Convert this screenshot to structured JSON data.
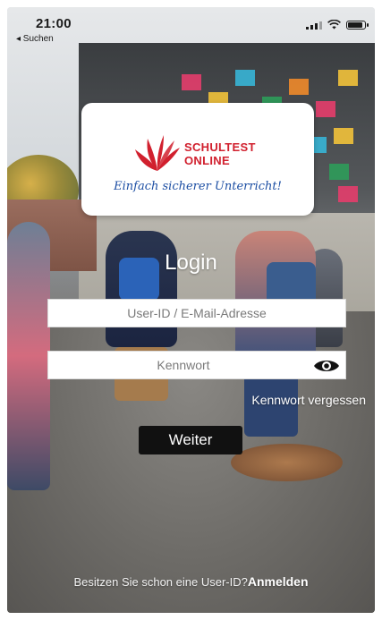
{
  "status_bar": {
    "time": "21:00",
    "back_label": "◂ Suchen"
  },
  "logo": {
    "line1": "SCHULTEST",
    "line2": "ONLINE",
    "tagline": "Einfach sicherer Unterricht!",
    "brand_color": "#d1202e",
    "tagline_color": "#1c4ea3"
  },
  "login": {
    "title": "Login",
    "user_placeholder": "User-ID / E-Mail-Adresse",
    "password_placeholder": "Kennwort",
    "forgot_password": "Kennwort vergessen",
    "submit_label": "Weiter"
  },
  "footer": {
    "question": "Besitzen Sie schon eine User-ID?",
    "link": "Anmelden"
  },
  "icons": [
    "signal-icon",
    "wifi-icon",
    "battery-icon",
    "eye-icon"
  ]
}
